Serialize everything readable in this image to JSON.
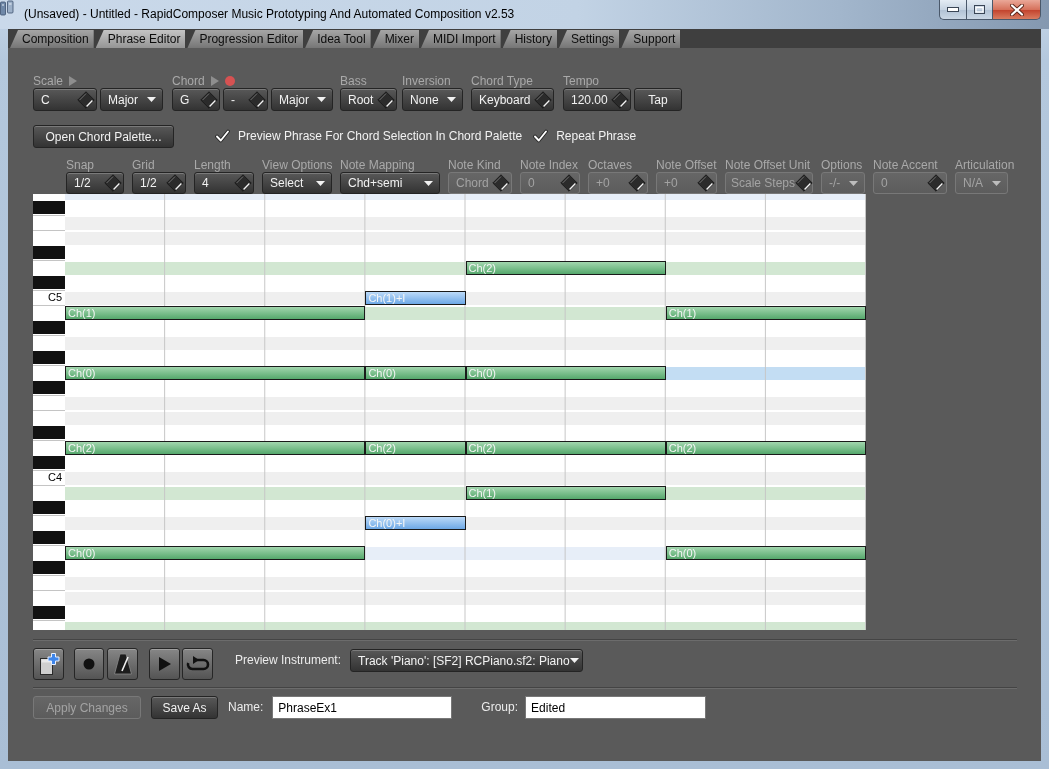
{
  "window": {
    "title": "(Unsaved) - Untitled - RapidComposer Music Prototyping And Automated Composition v2.53"
  },
  "tabs": [
    {
      "label": "Composition",
      "selected": false
    },
    {
      "label": "Phrase Editor",
      "selected": true
    },
    {
      "label": "Progression Editor",
      "selected": false
    },
    {
      "label": "Idea Tool",
      "selected": false
    },
    {
      "label": "Mixer",
      "selected": false
    },
    {
      "label": "MIDI Import",
      "selected": false
    },
    {
      "label": "History",
      "selected": false
    },
    {
      "label": "Settings",
      "selected": false
    },
    {
      "label": "Support",
      "selected": false
    }
  ],
  "chord_settings": [
    {
      "label": "Scale",
      "play_button": true,
      "record_button": false,
      "controls": [
        {
          "kind": "spin",
          "value": "C",
          "disabled": false
        },
        {
          "kind": "combo",
          "value": "Major",
          "disabled": false
        }
      ]
    },
    {
      "label": "Chord",
      "play_button": true,
      "record_button": true,
      "controls": [
        {
          "kind": "spin",
          "value": "G",
          "disabled": false
        },
        {
          "kind": "spin",
          "value": "-",
          "disabled": false
        },
        {
          "kind": "combo",
          "value": "Major",
          "disabled": false
        }
      ]
    },
    {
      "label": "Bass",
      "play_button": false,
      "record_button": false,
      "controls": [
        {
          "kind": "spin",
          "value": "Root",
          "disabled": false
        }
      ]
    },
    {
      "label": "Inversion",
      "play_button": false,
      "record_button": false,
      "controls": [
        {
          "kind": "combo",
          "value": "None",
          "disabled": false
        }
      ]
    },
    {
      "label": "Chord Type",
      "play_button": false,
      "record_button": false,
      "controls": [
        {
          "kind": "spin",
          "value": "Keyboard",
          "disabled": false
        }
      ]
    },
    {
      "label": "Tempo",
      "play_button": false,
      "record_button": false,
      "controls": [
        {
          "kind": "spin",
          "value": "120.00",
          "disabled": false
        },
        {
          "kind": "button",
          "value": "Tap",
          "disabled": false
        }
      ]
    }
  ],
  "palette_button": {
    "label": "Open Chord Palette..."
  },
  "checkboxes": [
    {
      "label": "Preview Phrase For Chord Selection In Chord Palette",
      "checked": true
    },
    {
      "label": "Repeat Phrase",
      "checked": true
    }
  ],
  "note_settings": [
    {
      "label": "Snap",
      "control": {
        "kind": "spin",
        "value": "1/2",
        "disabled": false
      }
    },
    {
      "label": "Grid",
      "control": {
        "kind": "spin",
        "value": "1/2",
        "disabled": false
      }
    },
    {
      "label": "Length",
      "control": {
        "kind": "spin",
        "value": "4",
        "disabled": false
      }
    },
    {
      "label": "View Options",
      "control": {
        "kind": "combo",
        "value": "Select",
        "disabled": false
      }
    },
    {
      "label": "Note Mapping",
      "control": {
        "kind": "combo",
        "value": "Chd+semi",
        "disabled": false
      }
    },
    {
      "label": "Note Kind",
      "control": {
        "kind": "spin",
        "value": "Chord",
        "disabled": true
      }
    },
    {
      "label": "Note Index",
      "control": {
        "kind": "spin",
        "value": "0",
        "disabled": true
      }
    },
    {
      "label": "Octaves",
      "control": {
        "kind": "spin",
        "value": "+0",
        "disabled": true
      }
    },
    {
      "label": "Note Offset",
      "control": {
        "kind": "spin",
        "value": "+0",
        "disabled": true
      }
    },
    {
      "label": "Note Offset Unit",
      "control": {
        "kind": "spin",
        "value": "Scale Steps",
        "disabled": true
      }
    },
    {
      "label": "Options",
      "control": {
        "kind": "combo",
        "value": "-/-",
        "disabled": true
      }
    },
    {
      "label": "Note Accent",
      "control": {
        "kind": "spin",
        "value": "0",
        "disabled": true
      }
    },
    {
      "label": "Articulation",
      "control": {
        "kind": "combo",
        "value": "N/A",
        "disabled": true
      }
    }
  ],
  "piano_roll": {
    "rows": [
      {
        "kind": "white",
        "cells": [
          {
            "kind": "faint"
          },
          {
            "kind": "faint"
          },
          {
            "kind": "faint"
          },
          {
            "kind": "faint"
          },
          {
            "kind": "faint"
          },
          {
            "kind": "faint"
          },
          {
            "kind": "faint"
          },
          {
            "kind": "faint"
          }
        ]
      },
      {
        "kind": "black"
      },
      {
        "kind": "white"
      },
      {
        "kind": "white"
      },
      {
        "kind": "black"
      },
      {
        "kind": "white",
        "cells": [
          {
            "kind": "tone"
          },
          {
            "kind": "tone"
          },
          {
            "kind": "tone"
          },
          {
            "kind": "tone"
          },
          {
            "kind": "chord",
            "label": "Ch(2)"
          },
          {
            "kind": "held"
          },
          {
            "kind": "tone"
          },
          {
            "kind": "tone"
          }
        ]
      },
      {
        "kind": "black"
      },
      {
        "kind": "white",
        "label": "C5",
        "cells": [
          {
            "kind": "empty"
          },
          {
            "kind": "empty"
          },
          {
            "kind": "empty"
          },
          {
            "kind": "passing",
            "label": "Ch(1)+I"
          },
          {
            "kind": "empty"
          },
          {
            "kind": "empty"
          },
          {
            "kind": "empty"
          },
          {
            "kind": "empty"
          }
        ]
      },
      {
        "kind": "white",
        "cells": [
          {
            "kind": "chord",
            "label": "Ch(1)"
          },
          {
            "kind": "held"
          },
          {
            "kind": "held"
          },
          {
            "kind": "tone"
          },
          {
            "kind": "tone"
          },
          {
            "kind": "tone"
          },
          {
            "kind": "chord",
            "label": "Ch(1)"
          },
          {
            "kind": "held"
          }
        ]
      },
      {
        "kind": "black"
      },
      {
        "kind": "white"
      },
      {
        "kind": "black"
      },
      {
        "kind": "white",
        "cells": [
          {
            "kind": "chord",
            "label": "Ch(0)"
          },
          {
            "kind": "held"
          },
          {
            "kind": "held"
          },
          {
            "kind": "chord",
            "label": "Ch(0)"
          },
          {
            "kind": "chord",
            "label": "Ch(0)"
          },
          {
            "kind": "held"
          },
          {
            "kind": "focus"
          },
          {
            "kind": "focus"
          }
        ]
      },
      {
        "kind": "black"
      },
      {
        "kind": "white"
      },
      {
        "kind": "white"
      },
      {
        "kind": "black"
      },
      {
        "kind": "white",
        "cells": [
          {
            "kind": "chord",
            "label": "Ch(2)"
          },
          {
            "kind": "held"
          },
          {
            "kind": "held"
          },
          {
            "kind": "chord",
            "label": "Ch(2)"
          },
          {
            "kind": "chord",
            "label": "Ch(2)"
          },
          {
            "kind": "held"
          },
          {
            "kind": "chord",
            "label": "Ch(2)"
          },
          {
            "kind": "held"
          }
        ]
      },
      {
        "kind": "black"
      },
      {
        "kind": "white",
        "label": "C4"
      },
      {
        "kind": "white",
        "cells": [
          {
            "kind": "tone"
          },
          {
            "kind": "tone"
          },
          {
            "kind": "tone"
          },
          {
            "kind": "tone"
          },
          {
            "kind": "chord",
            "label": "Ch(1)"
          },
          {
            "kind": "held"
          },
          {
            "kind": "tone"
          },
          {
            "kind": "tone"
          }
        ]
      },
      {
        "kind": "black"
      },
      {
        "kind": "white",
        "cells": [
          {
            "kind": "empty"
          },
          {
            "kind": "empty"
          },
          {
            "kind": "empty"
          },
          {
            "kind": "passing",
            "label": "Ch(0)+I"
          },
          {
            "kind": "empty"
          },
          {
            "kind": "empty"
          },
          {
            "kind": "empty"
          },
          {
            "kind": "empty"
          }
        ]
      },
      {
        "kind": "black"
      },
      {
        "kind": "white",
        "cells": [
          {
            "kind": "chord",
            "label": "Ch(0)"
          },
          {
            "kind": "held"
          },
          {
            "kind": "held"
          },
          {
            "kind": "faint"
          },
          {
            "kind": "faint"
          },
          {
            "kind": "faint"
          },
          {
            "kind": "chord",
            "label": "Ch(0)"
          },
          {
            "kind": "held"
          }
        ]
      },
      {
        "kind": "black"
      },
      {
        "kind": "white"
      },
      {
        "kind": "white"
      },
      {
        "kind": "black"
      },
      {
        "kind": "white",
        "cells": [
          {
            "kind": "tone"
          },
          {
            "kind": "tone"
          },
          {
            "kind": "tone"
          },
          {
            "kind": "tone"
          },
          {
            "kind": "tone"
          },
          {
            "kind": "tone"
          },
          {
            "kind": "tone"
          },
          {
            "kind": "tone"
          }
        ]
      }
    ]
  },
  "preview_instrument": {
    "label": "Preview Instrument:",
    "value": "Track 'Piano': [SF2] RCPiano.sf2: Piano"
  },
  "footer": {
    "buttons": [
      {
        "label": "Apply Changes",
        "disabled": true
      },
      {
        "label": "Save As",
        "disabled": false
      }
    ],
    "fields": [
      {
        "label": "Name:",
        "value": "PhraseEx1"
      },
      {
        "label": "Group:",
        "value": "Edited"
      }
    ]
  }
}
